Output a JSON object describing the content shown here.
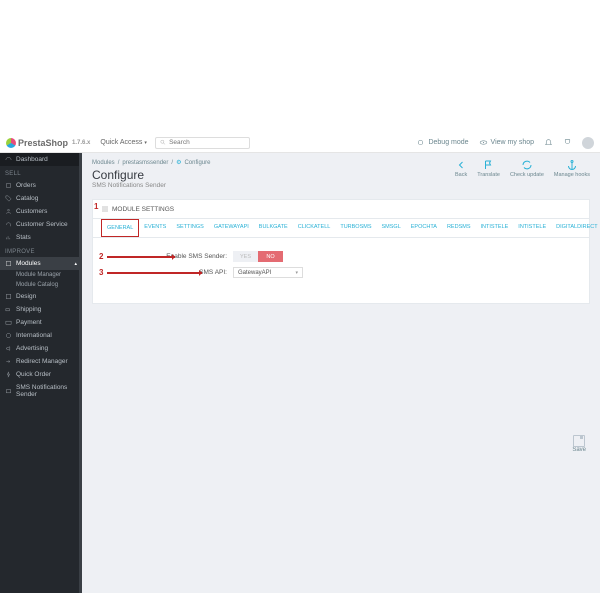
{
  "topbar": {
    "brand": "PrestaShop",
    "version": "1.7.6.x",
    "quick_access": "Quick Access",
    "search_placeholder": "Search",
    "debug": "Debug mode",
    "view_shop": "View my shop"
  },
  "sidebar": {
    "dashboard": "Dashboard",
    "sell": "Sell",
    "orders": "Orders",
    "catalog": "Catalog",
    "customers": "Customers",
    "customer_service": "Customer Service",
    "stats": "Stats",
    "improve": "Improve",
    "modules": "Modules",
    "module_manager": "Module Manager",
    "module_catalog": "Module Catalog",
    "design": "Design",
    "shipping": "Shipping",
    "payment": "Payment",
    "international": "International",
    "advertising": "Advertising",
    "redirect_manager": "Redirect Manager",
    "quick_order": "Quick Order",
    "sms": "SMS Notifications Sender"
  },
  "breadcrumb": {
    "a": "Modules",
    "b": "prestasmssender",
    "c": "Configure",
    "sep": "/"
  },
  "page": {
    "title": "Configure",
    "subtitle": "SMS Notifications Sender"
  },
  "actions": {
    "back": "Back",
    "translate": "Translate",
    "check": "Check update",
    "hooks": "Manage hooks"
  },
  "panel": {
    "title": "MODULE SETTINGS"
  },
  "tabs": [
    "GENERAL",
    "EVENTS",
    "SETTINGS",
    "GATEWAYAPI",
    "BULKGATE",
    "CLICKATELL",
    "TURBOSMS",
    "SMSGL",
    "EPOCHTA",
    "REDSMS",
    "INTISTELE",
    "INTISTELE",
    "DIGITALDIRECT"
  ],
  "fields": {
    "enable": {
      "label": "Enable SMS Sender:",
      "yes": "YES",
      "no": "NO"
    },
    "api": {
      "label": "SMS API:",
      "value": "GatewayAPI"
    }
  },
  "save": "Save",
  "annotations": {
    "n1": "1",
    "n2": "2",
    "n3": "3"
  }
}
